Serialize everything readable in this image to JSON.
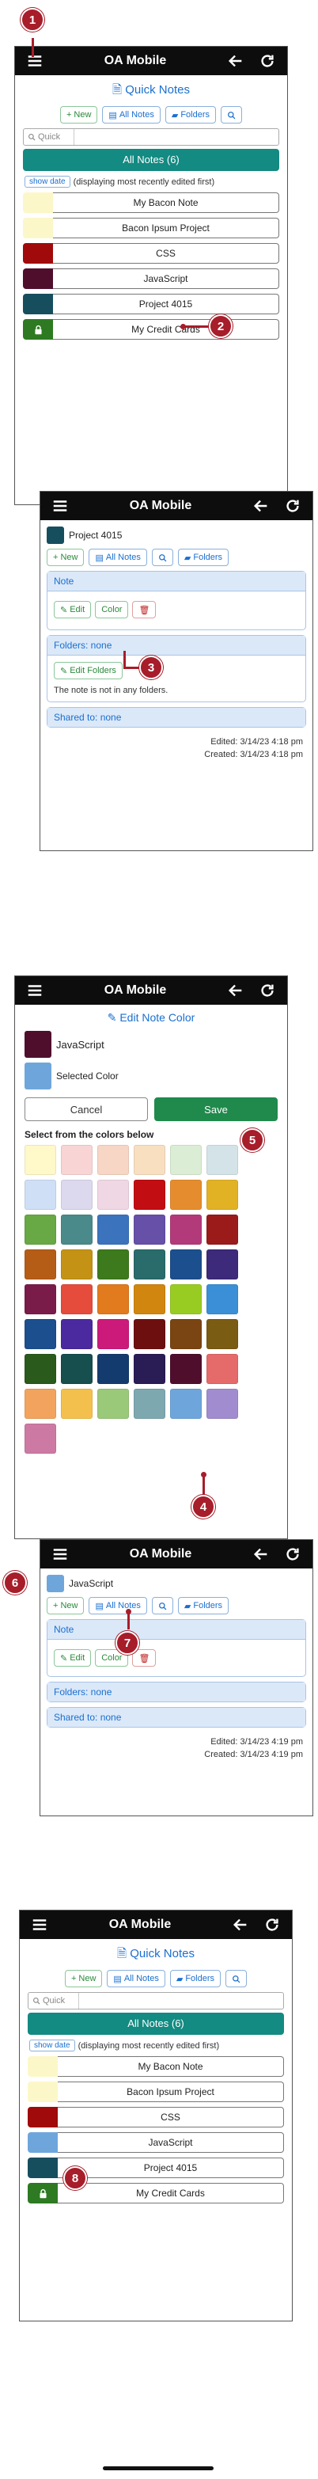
{
  "app_title": "OA Mobile",
  "screen1": {
    "heading": "Quick Notes",
    "buttons": {
      "new": "New",
      "all_notes": "All Notes",
      "folders": "Folders"
    },
    "quick_placeholder": "Quick",
    "all_notes_bar": "All Notes (6)",
    "show_date": "show date",
    "show_date_note": "(displaying most recently edited first)",
    "notes": [
      {
        "label": "My Bacon Note",
        "color": "#fcf7c8"
      },
      {
        "label": "Bacon Ipsum Project",
        "color": "#fcf7c8"
      },
      {
        "label": "CSS",
        "color": "#a00a0a"
      },
      {
        "label": "JavaScript",
        "color": "#4f0f2c"
      },
      {
        "label": "Project 4015",
        "color": "#174e5e"
      },
      {
        "label": "My Credit Cards",
        "color": "#2d7a22"
      }
    ]
  },
  "screen2": {
    "note_title": "Project 4015",
    "note_color": "#174e5e",
    "buttons": {
      "new": "New",
      "all_notes": "All Notes",
      "folders": "Folders"
    },
    "note_panel_title": "Note",
    "edit": "Edit",
    "color": "Color",
    "folders_panel_title": "Folders: none",
    "edit_folders": "Edit Folders",
    "not_in_folders": "The note is not in any folders.",
    "shared_panel_title": "Shared to: none",
    "edited": "Edited: 3/14/23 4:18 pm",
    "created": "Created: 3/14/23 4:18 pm"
  },
  "screen3": {
    "heading": "Edit Note Color",
    "note_name": "JavaScript",
    "note_color": "#4f0f2c",
    "selected_color_label": "Selected Color",
    "selected_color": "#6ea6dc",
    "cancel": "Cancel",
    "save": "Save",
    "select_label": "Select from the colors below",
    "palette": [
      "#fff8c8",
      "#f8d4d4",
      "#f7d6c5",
      "#f8dfc0",
      "#dbeed5",
      "#d3e3e8",
      "#cfdff5",
      "#dcd8ee",
      "#f0d7e4",
      "#c20e12",
      "#e58d2e",
      "#e2b225",
      "#68a845",
      "#4a8a8a",
      "#3b74bd",
      "#6650a8",
      "#b33a7a",
      "#9b1b1b",
      "#b55d17",
      "#c49316",
      "#3d7a1d",
      "#2a6b6b",
      "#1c4f8e",
      "#3d2a7a",
      "#7a1c4a",
      "#e54c3c",
      "#e27a1e",
      "#d1860f",
      "#99cc22",
      "#3b8fd6",
      "#1c4f8e",
      "#4a2a9e",
      "#cc1a7a",
      "#6e0f0f",
      "#7a4512",
      "#7a5c12",
      "#2a5a1c",
      "#174e4e",
      "#143b6e",
      "#2a1c55",
      "#4f0f2c",
      "#e56a6a",
      "#f2a45e",
      "#f4c04d",
      "#9bc97a",
      "#7da8b0",
      "#6ea6dc",
      "#a08ccf",
      "#cc7aa3"
    ]
  },
  "screen4": {
    "note_title": "JavaScript",
    "note_color": "#6ea6dc",
    "buttons": {
      "new": "New",
      "all_notes": "All Notes",
      "folders": "Folders"
    },
    "note_panel_title": "Note",
    "edit": "Edit",
    "color": "Color",
    "folders_panel_title": "Folders: none",
    "shared_panel_title": "Shared to: none",
    "edited": "Edited: 3/14/23 4:19 pm",
    "created": "Created: 3/14/23 4:19 pm"
  },
  "screen5": {
    "heading": "Quick Notes",
    "buttons": {
      "new": "New",
      "all_notes": "All Notes",
      "folders": "Folders"
    },
    "quick_placeholder": "Quick",
    "all_notes_bar": "All Notes (6)",
    "show_date": "show date",
    "show_date_note": "(displaying most recently edited first)",
    "notes": [
      {
        "label": "My Bacon Note",
        "color": "#fcf7c8"
      },
      {
        "label": "Bacon Ipsum Project",
        "color": "#fcf7c8"
      },
      {
        "label": "CSS",
        "color": "#a00a0a"
      },
      {
        "label": "JavaScript",
        "color": "#6ea6dc"
      },
      {
        "label": "Project 4015",
        "color": "#174e5e"
      },
      {
        "label": "My Credit Cards",
        "color": "#2d7a22"
      }
    ]
  },
  "markers": [
    "1",
    "2",
    "3",
    "4",
    "5",
    "6",
    "7",
    "8"
  ],
  "colors": {
    "marker": "#a71d2a",
    "teal_bar": "#138a82",
    "save": "#1f8a4c",
    "link_blue": "#1a6fd0"
  }
}
